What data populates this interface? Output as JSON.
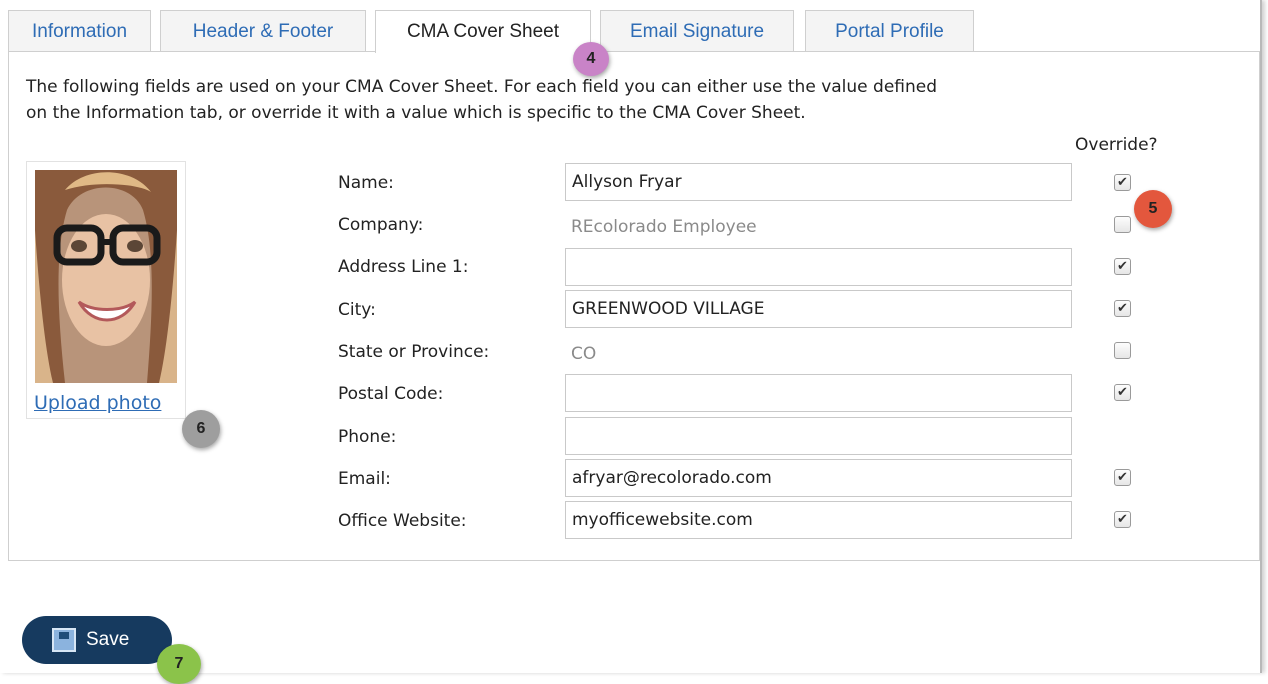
{
  "tabs": [
    {
      "label": "Information"
    },
    {
      "label": "Header & Footer"
    },
    {
      "label": "CMA Cover Sheet"
    },
    {
      "label": "Email Signature"
    },
    {
      "label": "Portal Profile"
    }
  ],
  "intro": {
    "line1": "The following fields are used on your CMA Cover Sheet. For each field you can either use the value defined",
    "line2": "on the Information tab, or override it with a value which is specific to the CMA Cover Sheet."
  },
  "override_header": "Override?",
  "photo": {
    "upload_label": "Upload photo"
  },
  "fields": {
    "name": {
      "label": "Name:",
      "value": "Allyson Fryar",
      "override": true
    },
    "company": {
      "label": "Company:",
      "value": "REcolorado Employee",
      "override": false
    },
    "address1": {
      "label": "Address Line 1:",
      "value": "",
      "override": true
    },
    "city": {
      "label": "City:",
      "value": "GREENWOOD VILLAGE",
      "override": true
    },
    "state": {
      "label": "State or Province:",
      "value": "CO",
      "override": false
    },
    "postal": {
      "label": "Postal Code:",
      "value": "",
      "override": true
    },
    "phone": {
      "label": "Phone:",
      "value": ""
    },
    "email": {
      "label": "Email:",
      "value": "afryar@recolorado.com",
      "override": true
    },
    "website": {
      "label": "Office Website:",
      "value": "myofficewebsite.com",
      "override": true
    }
  },
  "badges": {
    "b4": "4",
    "b5": "5",
    "b6": "6",
    "b7": "7"
  },
  "save": {
    "label": "Save"
  },
  "colors": {
    "tab_link": "#2e6cb5",
    "save_bg": "#163a5f",
    "badge4": "#c983c7",
    "badge5": "#e3573d",
    "badge6": "#9e9e9e",
    "badge7": "#8bc34a"
  }
}
